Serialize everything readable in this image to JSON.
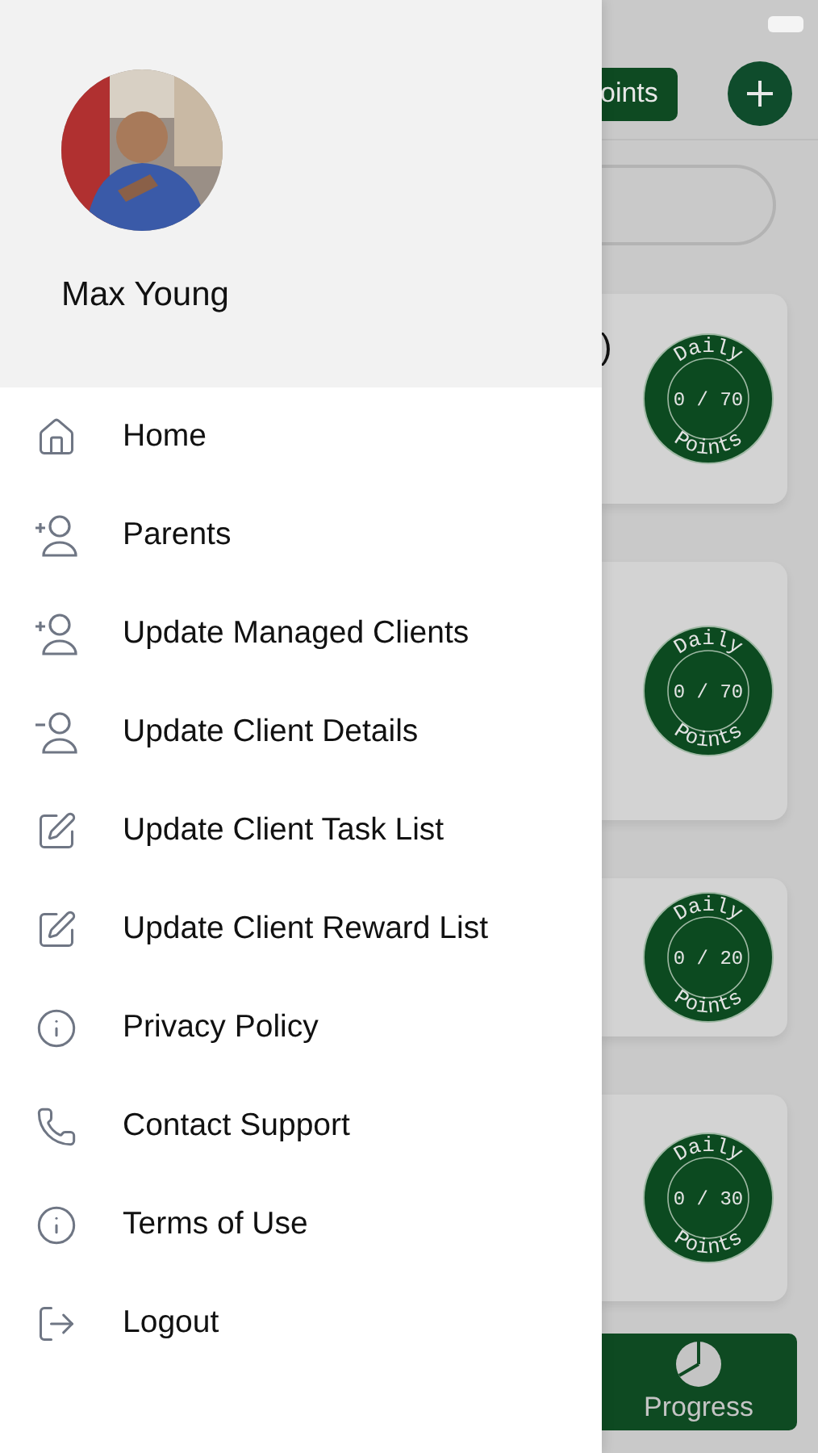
{
  "drawer": {
    "profile": {
      "name": "Max Young"
    },
    "items": [
      {
        "label": "Home",
        "kind": "home"
      },
      {
        "label": "Parents",
        "kind": "add"
      },
      {
        "label": "Update Managed Clients",
        "kind": "add"
      },
      {
        "label": "Update Client Details",
        "kind": "remove"
      },
      {
        "label": "Update Client Task List",
        "kind": "edit"
      },
      {
        "label": "Update Client Reward List",
        "kind": "edit"
      },
      {
        "label": "Privacy Policy",
        "kind": "info"
      },
      {
        "label": "Contact Support",
        "kind": "phone"
      },
      {
        "label": "Terms of Use",
        "kind": "info"
      },
      {
        "label": "Logout",
        "kind": "logout"
      }
    ]
  },
  "background": {
    "points_button": "oints",
    "cards": [
      {
        "title": ")",
        "badge": {
          "top": "Daily",
          "value": "0 / 70",
          "bottom": "Points"
        }
      },
      {
        "badge": {
          "top": "Daily",
          "value": "0 / 70",
          "bottom": "Points"
        }
      },
      {
        "badge": {
          "top": "Daily",
          "value": "0 / 20",
          "bottom": "Points"
        }
      },
      {
        "badge": {
          "top": "Daily",
          "value": "0 / 30",
          "bottom": "Points"
        }
      }
    ],
    "tab": {
      "label": "Progress"
    }
  }
}
